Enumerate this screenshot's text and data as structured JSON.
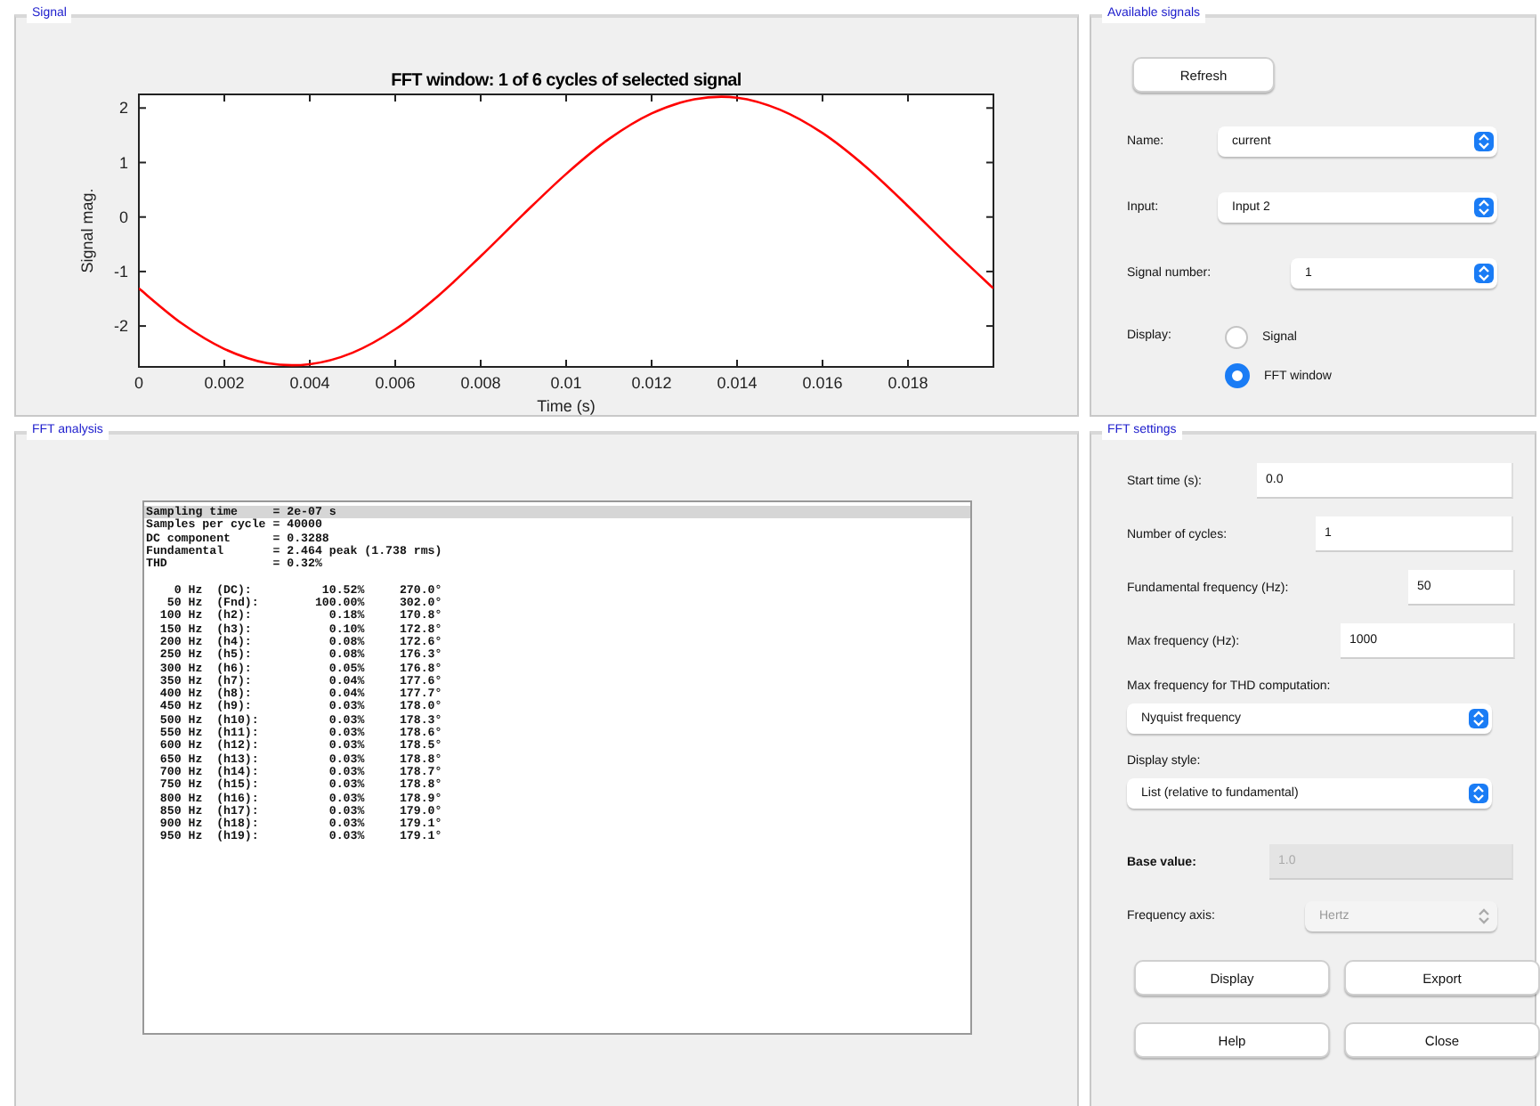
{
  "signal_panel": {
    "title": "Signal",
    "chart_data": {
      "type": "line",
      "title": "FFT window: 1 of 6 cycles of selected signal",
      "xlabel": "Time (s)",
      "ylabel": "Signal mag.",
      "x": [
        0,
        0.001,
        0.002,
        0.003,
        0.004,
        0.005,
        0.006,
        0.007,
        0.008,
        0.009,
        0.01,
        0.011,
        0.012,
        0.013,
        0.014,
        0.015,
        0.016,
        0.017,
        0.018,
        0.019,
        0.02
      ],
      "series": [
        {
          "color": "#ff0000",
          "values": [
            -1.31,
            -1.95,
            -2.42,
            -2.68,
            -2.7,
            -2.49,
            -2.06,
            -1.45,
            -0.72,
            0.05,
            0.79,
            1.43,
            1.9,
            2.16,
            2.19,
            1.97,
            1.54,
            0.93,
            0.2,
            -0.57,
            -1.31
          ]
        }
      ],
      "xlim": [
        0,
        0.02
      ],
      "ylim": [
        -2.75,
        2.25
      ],
      "xticks": [
        0,
        0.002,
        0.004,
        0.006,
        0.008,
        0.01,
        0.012,
        0.014,
        0.016,
        0.018
      ],
      "yticks": [
        -2,
        -1,
        0,
        1,
        2
      ]
    }
  },
  "available_signals": {
    "title": "Available signals",
    "refresh": "Refresh",
    "selects": [
      {
        "label": "Name:",
        "value": "current"
      },
      {
        "label": "Input:",
        "value": "Input 2"
      },
      {
        "label": "Signal number:",
        "value": "1"
      }
    ],
    "display": {
      "label": "Display:",
      "options": [
        {
          "label": "Signal",
          "selected": false
        },
        {
          "label": "FFT window",
          "selected": true
        }
      ]
    }
  },
  "fft_analysis": {
    "title": "FFT analysis",
    "lines": [
      {
        "text": "Sampling time     = 2e-07 s",
        "selected": true
      },
      {
        "text": "Samples per cycle = 40000",
        "selected": false
      },
      {
        "text": "DC component      = 0.3288",
        "selected": false
      },
      {
        "text": "Fundamental       = 2.464 peak (1.738 rms)",
        "selected": false
      },
      {
        "text": "THD               = 0.32%",
        "selected": false
      },
      {
        "selected": false
      },
      {
        "text": "    0 Hz  (DC):          10.52%     270.0°",
        "selected": false
      },
      {
        "text": "   50 Hz  (Fnd):        100.00%     302.0°",
        "selected": false
      },
      {
        "text": "  100 Hz  (h2):           0.18%     170.8°",
        "selected": false
      },
      {
        "text": "  150 Hz  (h3):           0.10%     172.8°",
        "selected": false
      },
      {
        "text": "  200 Hz  (h4):           0.08%     172.6°",
        "selected": false
      },
      {
        "text": "  250 Hz  (h5):           0.08%     176.3°",
        "selected": false
      },
      {
        "text": "  300 Hz  (h6):           0.05%     176.8°",
        "selected": false
      },
      {
        "text": "  350 Hz  (h7):           0.04%     177.6°",
        "selected": false
      },
      {
        "text": "  400 Hz  (h8):           0.04%     177.7°",
        "selected": false
      },
      {
        "text": "  450 Hz  (h9):           0.03%     178.0°",
        "selected": false
      },
      {
        "text": "  500 Hz  (h10):          0.03%     178.3°",
        "selected": false
      },
      {
        "text": "  550 Hz  (h11):          0.03%     178.6°",
        "selected": false
      },
      {
        "text": "  600 Hz  (h12):          0.03%     178.5°",
        "selected": false
      },
      {
        "text": "  650 Hz  (h13):          0.03%     178.8°",
        "selected": false
      },
      {
        "text": "  700 Hz  (h14):          0.03%     178.7°",
        "selected": false
      },
      {
        "text": "  750 Hz  (h15):          0.03%     178.8°",
        "selected": false
      },
      {
        "text": "  800 Hz  (h16):          0.03%     178.9°",
        "selected": false
      },
      {
        "text": "  850 Hz  (h17):          0.03%     179.0°",
        "selected": false
      },
      {
        "text": "  900 Hz  (h18):          0.03%     179.1°",
        "selected": false
      },
      {
        "text": "  950 Hz  (h19):          0.03%     179.1°",
        "selected": false
      }
    ]
  },
  "fft_settings": {
    "title": "FFT settings",
    "fields": [
      {
        "kind": "input",
        "label": "Start time (s):",
        "value": "0.0",
        "disabled": false
      },
      {
        "kind": "input",
        "label": "Number of cycles:",
        "value": "1",
        "disabled": false
      },
      {
        "kind": "input",
        "label": "Fundamental frequency (Hz):",
        "value": "50",
        "disabled": false
      },
      {
        "kind": "input",
        "label": "Max frequency (Hz):",
        "value": "1000",
        "disabled": false
      },
      {
        "kind": "select_below",
        "label": "Max frequency for THD computation:",
        "value": "Nyquist frequency",
        "disabled": false
      },
      {
        "kind": "select_below",
        "label": "Display style:",
        "value": "List (relative to fundamental)",
        "disabled": false
      },
      {
        "kind": "input",
        "label": "Base value:",
        "value": "1.0",
        "disabled": true
      },
      {
        "kind": "select",
        "label": "Frequency axis:",
        "value": "Hertz",
        "disabled": true
      }
    ],
    "buttons": [
      "Display",
      "Export",
      "Help",
      "Close"
    ]
  }
}
